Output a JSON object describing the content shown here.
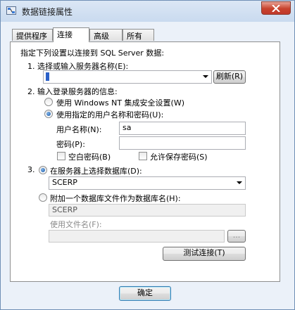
{
  "window": {
    "title": "数据链接属性"
  },
  "tabs": [
    {
      "label": "提供程序"
    },
    {
      "label": "连接"
    },
    {
      "label": "高级"
    },
    {
      "label": "所有"
    }
  ],
  "connection": {
    "instruction": "指定下列设置以连接到 SQL Server 数据:",
    "step1_label": "1. 选择或输入服务器名称(E):",
    "server_value": "",
    "refresh_label": "刷新(R)",
    "step2_label": "2. 输入登录服务器的信息:",
    "radio_windows_nt": "使用 Windows NT 集成安全设置(W)",
    "radio_specific_user": "使用指定的用户名称和密码(U):",
    "username_label": "用户名称(N):",
    "username_value": "sa",
    "password_label": "密码(P):",
    "password_value": "",
    "blank_password_label": "空白密码(B)",
    "allow_save_password_label": "允许保存密码(S)",
    "step3_label": "3.",
    "radio_select_db": "在服务器上选择数据库(D):",
    "database_value": "SCERP",
    "radio_attach_file": "附加一个数据库文件作为数据库名(H):",
    "attach_name_value": "SCERP",
    "use_filename_label": "使用文件名(F):",
    "filename_value": "",
    "browse_label": "...",
    "test_connection_label": "测试连接(T)"
  },
  "footer": {
    "ok_label": "确定"
  },
  "colors": {
    "accent": "#2b61c8",
    "frame": "#ebf1f9"
  }
}
